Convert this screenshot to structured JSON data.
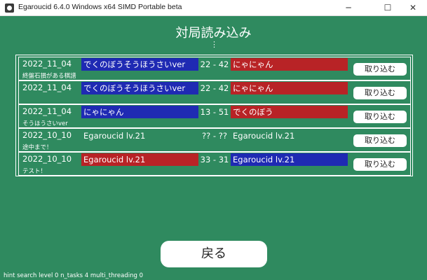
{
  "window": {
    "title": "Egaroucid 6.4.0 Windows x64 SIMD Portable beta",
    "icon": "egaroucid-app-icon",
    "controls": {
      "minimize": "─",
      "maximize": "☐",
      "close": "✕"
    }
  },
  "header": {
    "title": "対局読み込み",
    "more_indicator": "⋮"
  },
  "games": [
    {
      "date": "2022_11_04",
      "memo": "終盤石損がある棋譜",
      "black": "でくのぼうそうほうさいver",
      "score": "22 - 42",
      "white": "にゃにゃん",
      "black_color": "#1f2ab3",
      "white_color": "#b82326",
      "import_label": "取り込む"
    },
    {
      "date": "2022_11_04",
      "memo": "",
      "black": "でくのぼうそうほうさいver",
      "score": "22 - 42",
      "white": "にゃにゃん",
      "black_color": "#1f2ab3",
      "white_color": "#b82326",
      "import_label": "取り込む"
    },
    {
      "date": "2022_11_04",
      "memo": "そうほうさいver",
      "black": "にゃにゃん",
      "score": "13 - 51",
      "white": "でくのぼう",
      "black_color": "#1f2ab3",
      "white_color": "#b82326",
      "import_label": "取り込む"
    },
    {
      "date": "2022_10_10",
      "memo": "途中まで！",
      "black": "Egaroucid lv.21",
      "score": "?? - ??",
      "white": "Egaroucid lv.21",
      "black_color": "",
      "white_color": "",
      "import_label": "取り込む"
    },
    {
      "date": "2022_10_10",
      "memo": "テスト！",
      "black": "Egaroucid lv.21",
      "score": "33 - 31",
      "white": "Egaroucid lv.21",
      "black_color": "#b82326",
      "white_color": "#1f2ab3",
      "import_label": "取り込む"
    }
  ],
  "footer": {
    "back_label": "戻る",
    "status": "hint search level 0 n_tasks 4 multi_threading 0"
  },
  "colors": {
    "background": "#2f8a5f",
    "blue": "#1f2ab3",
    "red": "#b82326"
  }
}
